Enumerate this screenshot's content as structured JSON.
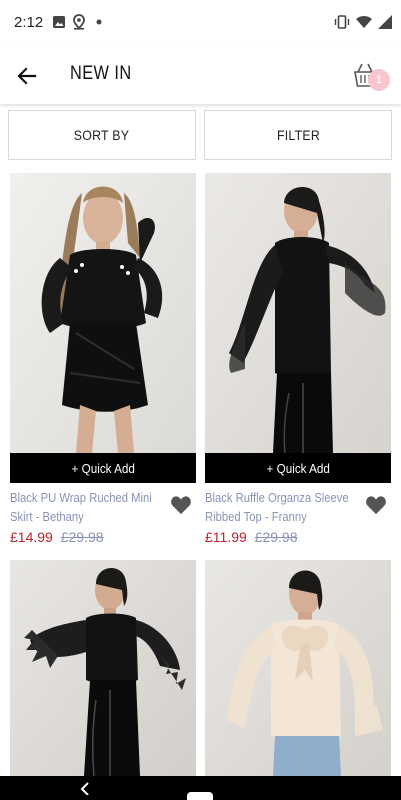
{
  "status_bar": {
    "time": "2:12",
    "left_icons": [
      "image-icon",
      "location-pin-icon",
      "dot-icon"
    ],
    "right_icons": [
      "vibrate-icon",
      "wifi-icon",
      "signal-icon"
    ]
  },
  "header": {
    "title": "NEW IN",
    "basket_count": "1"
  },
  "toolbar": {
    "sort_label": "SORT BY",
    "filter_label": "FILTER"
  },
  "products": [
    {
      "name_line1": "Black PU Wrap Ruched Mini",
      "name_line2": "Skirt - Bethany",
      "price": "£14.99",
      "was_price": "£29.98",
      "quick_add": "+ Quick Add"
    },
    {
      "name_line1": "Black Ruffle Organza Sleeve",
      "name_line2": "Ribbed Top - Franny",
      "price": "£11.99",
      "was_price": "£29.98",
      "quick_add": "+ Quick Add"
    },
    {
      "name_line1": "",
      "name_line2": "",
      "price": "",
      "was_price": "",
      "quick_add": ""
    },
    {
      "name_line1": "",
      "name_line2": "",
      "price": "",
      "was_price": "",
      "quick_add": ""
    }
  ],
  "colors": {
    "price_sale": "#c0202c",
    "name_text": "#8a93b4",
    "badge": "#f7c6cf",
    "quick_add_bg": "#000000"
  }
}
